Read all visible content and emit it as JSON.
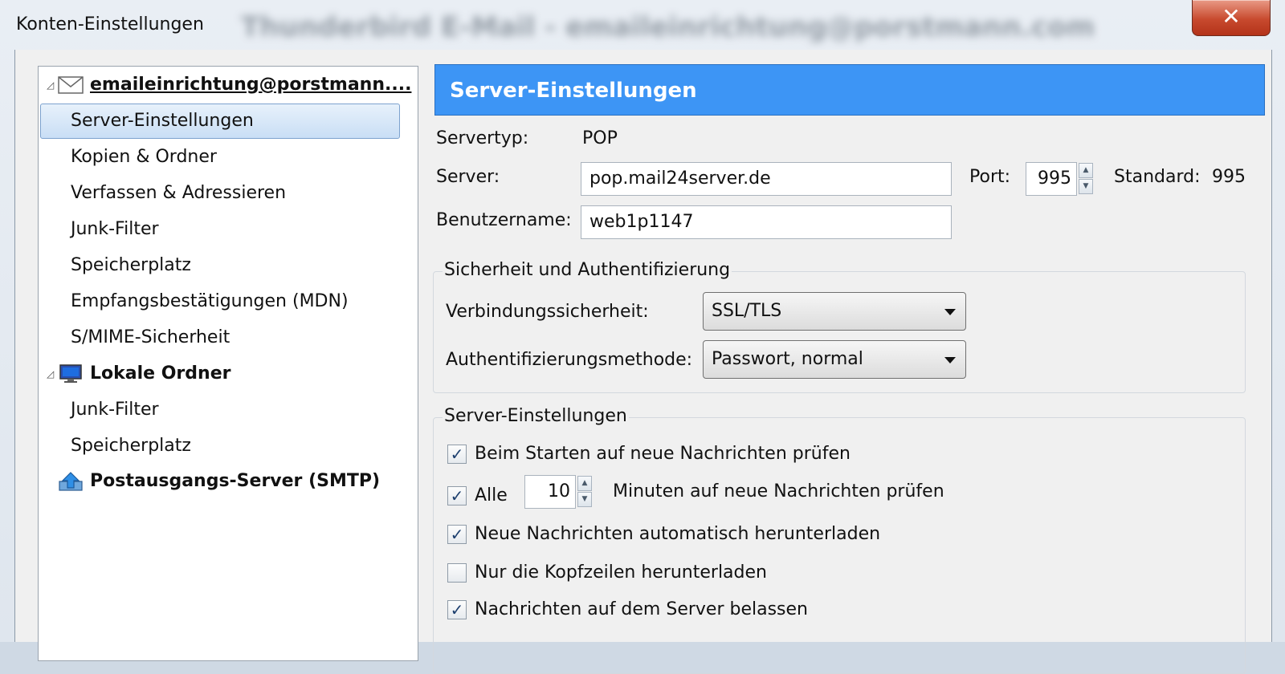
{
  "window": {
    "background_title": "Thunderbird E-Mail - emaileinrichtung@porstmann.com",
    "dialog_title": "Konten-Einstellungen",
    "close_symbol": "✕"
  },
  "sidebar": {
    "account": {
      "label": "emaileinrichtung@porstmann....",
      "icon": "envelope-icon",
      "children": [
        "Server-Einstellungen",
        "Kopien & Ordner",
        "Verfassen & Adressieren",
        "Junk-Filter",
        "Speicherplatz",
        "Empfangsbestätigungen (MDN)",
        "S/MIME-Sicherheit"
      ]
    },
    "local": {
      "label": "Lokale Ordner",
      "icon": "monitor-icon",
      "children": [
        "Junk-Filter",
        "Speicherplatz"
      ]
    },
    "smtp": {
      "label": "Postausgangs-Server (SMTP)",
      "icon": "smtp-upload-icon"
    },
    "selected": "Server-Einstellungen"
  },
  "panel": {
    "header": "Server-Einstellungen",
    "servertype_label": "Servertyp:",
    "servertype_value": "POP",
    "server_label": "Server:",
    "server_value": "pop.mail24server.de",
    "port_label": "Port:",
    "port_value": "995",
    "standard_label": "Standard:",
    "standard_value": "995",
    "username_label": "Benutzername:",
    "username_value": "web1p1147",
    "security": {
      "caption": "Sicherheit und Authentifizierung",
      "connection_label": "Verbindungssicherheit:",
      "connection_value": "SSL/TLS",
      "auth_label": "Authentifizierungsmethode:",
      "auth_value": "Passwort, normal"
    },
    "server_settings": {
      "caption": "Server-Einstellungen",
      "check_startup": {
        "label": "Beim Starten auf neue Nachrichten prüfen",
        "checked": true
      },
      "check_every": {
        "label": "Alle",
        "checked": true,
        "minutes": "10",
        "suffix": "Minuten auf neue Nachrichten prüfen"
      },
      "auto_download": {
        "label": "Neue Nachrichten automatisch herunterladen",
        "checked": true
      },
      "headers_only": {
        "label": "Nur die Kopfzeilen herunterladen",
        "checked": false
      },
      "leave_on_server": {
        "label": "Nachrichten auf dem Server belassen",
        "checked": true
      }
    }
  }
}
